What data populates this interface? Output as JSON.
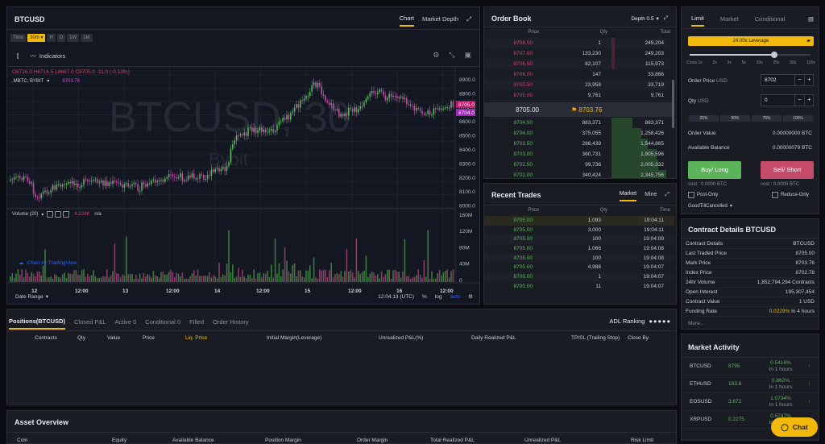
{
  "chart_panel": {
    "symbol": "BTCUSD",
    "tabs": [
      "Chart",
      "Market Depth"
    ],
    "timeframes": [
      "Time",
      "30m",
      "H",
      "D",
      "1W",
      "1M"
    ],
    "selected_timeframe": "30m",
    "indicators_label": "Indicators",
    "ohlc": "O8716.0 H8716.5 L8687.0 C8705.0 -11.0 (-0.13%)",
    "source": ".MBTC, BYBIT",
    "source_value": "8703.76",
    "watermark": "BTCUSD, 30",
    "watermark_sub": "Bybit",
    "volume_label": "Volume (20)",
    "volume_value": "4.224K",
    "volume_na": "n/a",
    "tradingview": "Chart by TradingView",
    "date_range": "Date Range",
    "time_readout": "12:04:13 (UTC)",
    "pct": "%",
    "log": "log",
    "auto": "auto",
    "price_ticks": [
      "8900.0",
      "8800.0",
      "8700.0",
      "8600.0",
      "8500.0",
      "8400.0",
      "8300.0",
      "8200.0",
      "8100.0",
      "8000.0"
    ],
    "price_tag_1": "8705.0",
    "price_tag_2": "8704.0",
    "vol_ticks": [
      "160M",
      "120M",
      "80M",
      "40M",
      "0"
    ],
    "x_ticks": [
      "12",
      "12:00",
      "13",
      "12:00",
      "14",
      "12:00",
      "15",
      "12:00",
      "16",
      "12:00"
    ]
  },
  "order_book": {
    "title": "Order Book",
    "depth": "Depth 0.5",
    "headers": [
      "Price",
      "Qty",
      "Total"
    ],
    "asks": [
      [
        "8708.00",
        "1",
        "249,204"
      ],
      [
        "8707.00",
        "133,230",
        "249,203"
      ],
      [
        "8706.50",
        "82,107",
        "115,973"
      ],
      [
        "8706.00",
        "147",
        "33,866"
      ],
      [
        "8705.50",
        "23,958",
        "33,719"
      ],
      [
        "8705.00",
        "9,761",
        "9,761"
      ]
    ],
    "last_price": "8705.00",
    "mark_price": "8703.76",
    "bids": [
      [
        "8704.50",
        "883,371",
        "883,371"
      ],
      [
        "8704.00",
        "375,055",
        "1,258,426"
      ],
      [
        "8703.50",
        "286,439",
        "1,544,865"
      ],
      [
        "8703.00",
        "360,731",
        "1,905,596"
      ],
      [
        "8702.50",
        "99,736",
        "2,005,332"
      ],
      [
        "8702.00",
        "340,424",
        "2,345,756"
      ]
    ]
  },
  "recent_trades": {
    "title": "Recent Trades",
    "tabs": [
      "Market",
      "Mine"
    ],
    "headers": [
      "Price",
      "Qty",
      "Time"
    ],
    "rows": [
      [
        "8705.00",
        "1,093",
        "19:04:11"
      ],
      [
        "8705.00",
        "3,000",
        "19:04:11"
      ],
      [
        "8705.00",
        "100",
        "19:04:09"
      ],
      [
        "8705.00",
        "1,066",
        "19:04:08"
      ],
      [
        "8705.00",
        "100",
        "19:04:08"
      ],
      [
        "8705.00",
        "4,988",
        "19:04:07"
      ],
      [
        "8705.00",
        "1",
        "19:04:07"
      ],
      [
        "8705.00",
        "11",
        "19:04:07"
      ]
    ]
  },
  "order_form": {
    "tabs": [
      "Limit",
      "Market",
      "Conditional"
    ],
    "leverage": "24.00x Leverage",
    "lev_ticks": [
      "Cross 1x",
      "2x",
      "3x",
      "5x",
      "10x",
      "25x",
      "50x",
      "100x"
    ],
    "order_price_label": "Order Price",
    "order_price_unit": "USD",
    "order_price": "8702",
    "qty_label": "Qty",
    "qty_unit": "USD",
    "qty": "0",
    "pcts": [
      "25%",
      "50%",
      "75%",
      "100%"
    ],
    "order_value_label": "Order Value",
    "order_value": "0.00000000 BTC",
    "avail_label": "Available Balance",
    "avail": "0.00000079 BTC",
    "buy": "Buy/ Long",
    "sell": "Sell/ Short",
    "cost_buy": "cost : 0.0000 BTC",
    "cost_sell": "cost : 0.0000 BTC",
    "post_only": "Post-Only",
    "reduce_only": "Reduce-Only",
    "tif": "GoodTillCancelled"
  },
  "contract": {
    "title": "Contract Details BTCUSD",
    "rows": [
      [
        "Contract Details",
        "BTCUSD"
      ],
      [
        "Last Traded Price",
        "8705.00"
      ],
      [
        "Mark Price",
        "8703.76"
      ],
      [
        "Index Price",
        "8702.78"
      ],
      [
        "24hr Volume",
        "1,852,794,294 Contracts"
      ],
      [
        "Open Interest",
        "195,307,454"
      ],
      [
        "Contract Value",
        "1 USD"
      ],
      [
        "Funding Rate",
        "0.0229% In 4 hours"
      ]
    ],
    "funding_pct": "0.0229%",
    "funding_when": "In 4 hours",
    "more": "More..."
  },
  "market_activity": {
    "title": "Market Activity",
    "rows": [
      [
        "BTCUSD",
        "8795",
        "0.5416%",
        "In 1 hours"
      ],
      [
        "ETHUSD",
        "163.8",
        "0.862%",
        "In 1 hours"
      ],
      [
        "EOSUSD",
        "3.672",
        "1.0734%",
        "In 1 hours"
      ],
      [
        "XRPUSD",
        "0.2275",
        "0.5747%",
        "In 1 hours"
      ]
    ]
  },
  "positions": {
    "tabs": [
      "Positions(BTCUSD)",
      "Closed P&L",
      "Active 0",
      "Conditional 0",
      "Filled",
      "Order History"
    ],
    "adl": "ADL Ranking",
    "headers": [
      "Contracts",
      "Qty",
      "Value",
      "Price",
      "Liq. Price",
      "Initial Margin(Leverage)",
      "Unrealized P&L(%)",
      "Daily Realized P&L",
      "TP/SL (Trailing Stop)",
      "Close By"
    ]
  },
  "asset_overview": {
    "title": "Asset Overview",
    "headers": [
      "Coin",
      "Equity",
      "Available Balance",
      "Position Margin",
      "Order Margin",
      "Total Realized P&L",
      "Unrealized P&L",
      "Risk Limit"
    ]
  },
  "chat": "Chat",
  "colors": {
    "accent": "#f0b90b",
    "up": "#5bb45a",
    "down": "#c44b6a",
    "bg": "#1a1c24"
  }
}
